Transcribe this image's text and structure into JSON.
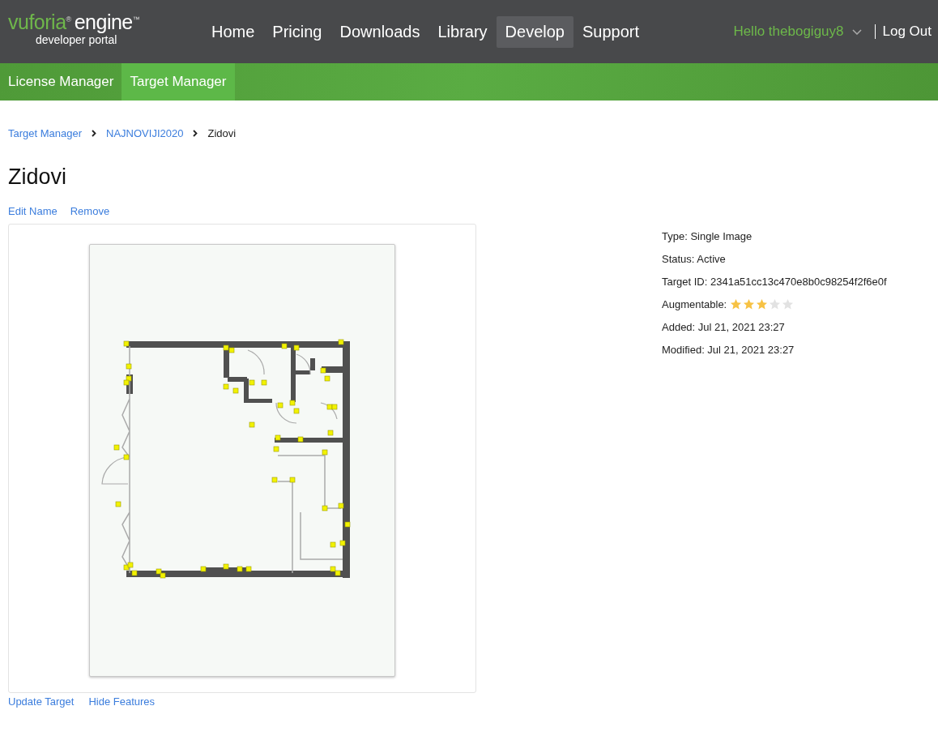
{
  "logo": {
    "brand": "vuforia$^{®}$",
    "product": "engine$^{™}$",
    "tagline": "developer portal"
  },
  "nav": [
    {
      "label": "Home",
      "selected": false
    },
    {
      "label": "Pricing",
      "selected": false
    },
    {
      "label": "Downloads",
      "selected": false
    },
    {
      "label": "Library",
      "selected": false
    },
    {
      "label": "Develop",
      "selected": true
    },
    {
      "label": "Support",
      "selected": false
    }
  ],
  "user": {
    "greeting": "Hello thebogiguy8",
    "logout": "Log Out"
  },
  "subnav": [
    {
      "label": "License Manager",
      "selected": false
    },
    {
      "label": "Target Manager",
      "selected": true
    }
  ],
  "breadcrumb": [
    {
      "label": "Target Manager",
      "kind": "link"
    },
    {
      "label": "NAJNOVIJI2020",
      "kind": "link"
    },
    {
      "label": "Zidovi",
      "kind": "current"
    }
  ],
  "title": "Zidovi",
  "title_actions": [
    "Edit Name",
    "Remove"
  ],
  "details": [
    {
      "text": "Type: Single Image",
      "kind": "text"
    },
    {
      "text": "Status: Active",
      "kind": "text"
    },
    {
      "text": "Target ID: 2341a51cc13c470e8b0c98254f2f6e0f",
      "kind": "text"
    },
    {
      "text": "Augmentable:",
      "kind": "rating",
      "stars": 3
    },
    {
      "text": "Added: Jul 21, 2021 23:27",
      "kind": "text"
    },
    {
      "text": "Modified: Jul 21, 2021 23:27",
      "kind": "text"
    }
  ],
  "image_actions": [
    "Update Target",
    "Hide Features"
  ]
}
